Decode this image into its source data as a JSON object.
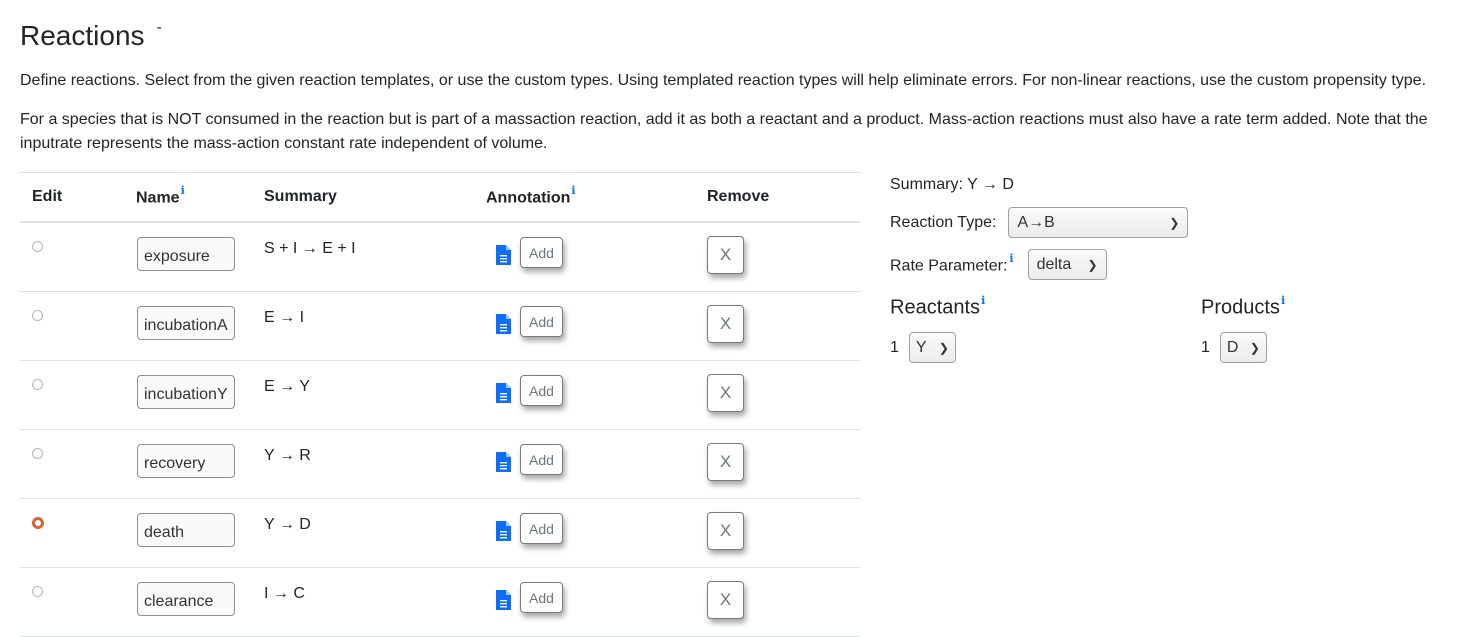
{
  "header": {
    "title": "Reactions",
    "collapse_label": "-",
    "description_1": "Define reactions. Select from the given reaction templates, or use the custom types. Using templated reaction types will help eliminate errors. For non-linear reactions, use the custom propensity type.",
    "description_2": "For a species that is NOT consumed in the reaction but is part of a massaction reaction, add it as both a reactant and a product. Mass-action reactions must also have a rate term added. Note that the inputrate represents the mass-action constant rate independent of volume."
  },
  "table": {
    "columns": {
      "edit": "Edit",
      "name": "Name",
      "summary": "Summary",
      "annotation": "Annotation",
      "remove": "Remove"
    },
    "info_marker": "i",
    "add_label": "Add",
    "remove_label": "X",
    "rows": [
      {
        "selected": false,
        "name": "exposure",
        "summary": "S + I → E + I"
      },
      {
        "selected": false,
        "name": "incubationA",
        "summary": "E → I"
      },
      {
        "selected": false,
        "name": "incubationY",
        "summary": "E → Y"
      },
      {
        "selected": false,
        "name": "recovery",
        "summary": "Y → R"
      },
      {
        "selected": true,
        "name": "death",
        "summary": "Y → D"
      },
      {
        "selected": false,
        "name": "clearance",
        "summary": "I → C"
      }
    ]
  },
  "detail": {
    "summary_label": "Summary:",
    "summary_value": "Y → D",
    "reaction_type_label": "Reaction Type:",
    "reaction_type_value": "A→B",
    "rate_parameter_label": "Rate Parameter:",
    "rate_parameter_value": "delta",
    "reactants_label": "Reactants",
    "products_label": "Products",
    "reactants": [
      {
        "ratio": "1",
        "species": "Y"
      }
    ],
    "products": [
      {
        "ratio": "1",
        "species": "D"
      }
    ]
  },
  "colors": {
    "accent_info": "#0d6efd",
    "radio_selected": "#d9623a",
    "doc_icon": "#0d6efd"
  }
}
